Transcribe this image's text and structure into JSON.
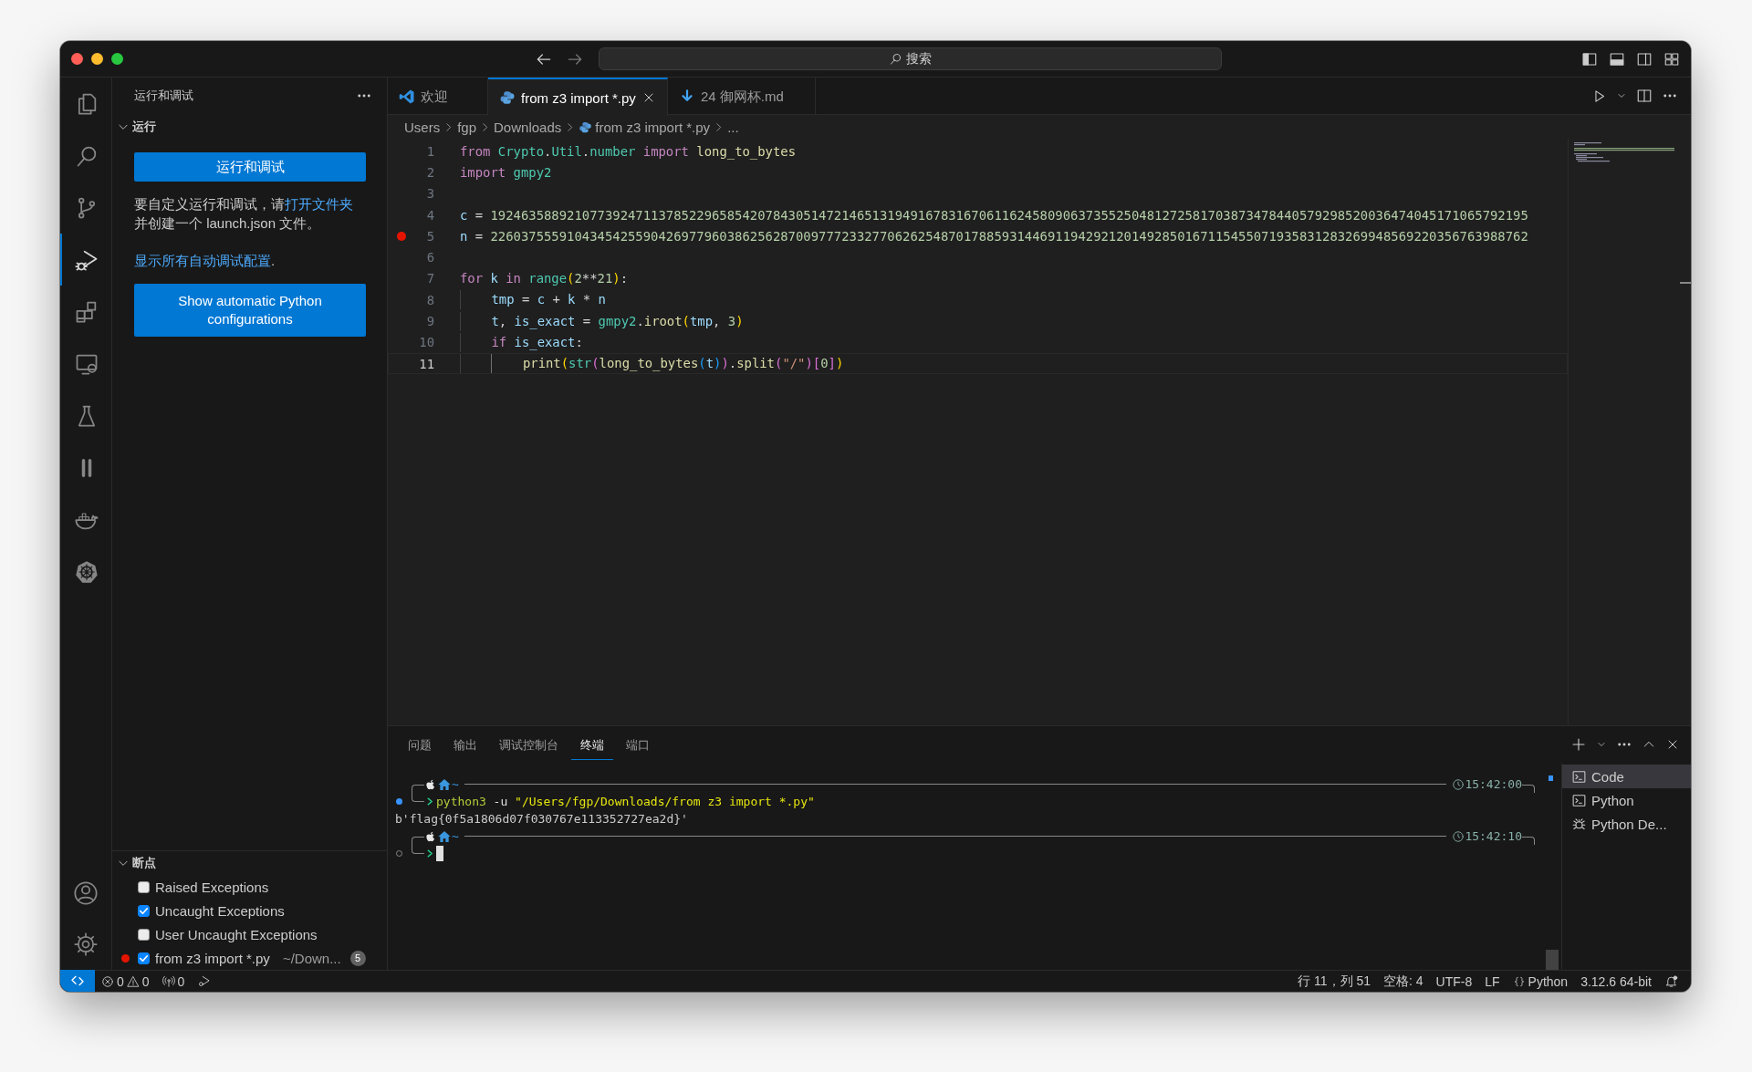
{
  "window": {
    "command_center": "搜索"
  },
  "activity_bar": [
    {
      "kind": "files",
      "selected": false
    },
    {
      "kind": "search",
      "selected": false
    },
    {
      "kind": "branch",
      "selected": false
    },
    {
      "kind": "debug",
      "selected": true
    },
    {
      "kind": "extensions",
      "selected": false
    },
    {
      "kind": "monitor",
      "selected": false
    },
    {
      "kind": "flask",
      "selected": false
    },
    {
      "kind": "pause",
      "selected": false
    },
    {
      "kind": "whale",
      "selected": false
    },
    {
      "kind": "wheel",
      "selected": false
    }
  ],
  "sidebar": {
    "title": "运行和调试",
    "section": "运行",
    "expanded": true,
    "run_button": "运行和调试",
    "help_before": "要自定义运行和调试，请",
    "help_link": "打开文件夹",
    "help_after": "并创建一个 launch.json 文件。",
    "show_all_link": "显示所有自动调试配置",
    "show_all_after": ".",
    "python_button": "Show automatic Python configurations",
    "breakpoints": {
      "title": "断点",
      "expanded": true,
      "items": [
        {
          "kind": "exception",
          "label": "Raised Exceptions",
          "checked": false
        },
        {
          "kind": "exception",
          "label": "Uncaught Exceptions",
          "checked": true
        },
        {
          "kind": "exception",
          "label": "User Uncaught Exceptions",
          "checked": false
        },
        {
          "kind": "file",
          "label": "from z3 import *.py",
          "path": "~/Down...",
          "count": "5",
          "checked": true
        }
      ]
    }
  },
  "tabs": [
    {
      "kind": "vscode",
      "label": "欢迎",
      "selected": false
    },
    {
      "kind": "python",
      "label": "from z3 import *.py",
      "selected": true
    },
    {
      "kind": "markdown",
      "label": "24 御网杯.md",
      "selected": false
    }
  ],
  "breadcrumb": [
    {
      "kind": "folder",
      "label": "Users"
    },
    {
      "kind": "folder",
      "label": "fgp"
    },
    {
      "kind": "folder",
      "label": "Downloads"
    },
    {
      "kind": "python",
      "label": "from z3 import *.py"
    },
    {
      "kind": "folder",
      "label": "..."
    }
  ],
  "code": [
    {
      "number": "1",
      "breakpoint": false,
      "current": false,
      "tokens": [
        {
          "text": "from ",
          "kind": "kw"
        },
        {
          "text": "Crypto",
          "kind": "mod"
        },
        {
          "text": ".",
          "kind": "op"
        },
        {
          "text": "Util",
          "kind": "mod"
        },
        {
          "text": ".",
          "kind": "op"
        },
        {
          "text": "number ",
          "kind": "mod"
        },
        {
          "text": "import ",
          "kind": "kw"
        },
        {
          "text": "long_to_bytes",
          "kind": "fn"
        }
      ]
    },
    {
      "number": "2",
      "breakpoint": false,
      "current": false,
      "tokens": [
        {
          "text": "import ",
          "kind": "kw"
        },
        {
          "text": "gmpy2",
          "kind": "mod"
        }
      ]
    },
    {
      "number": "3",
      "breakpoint": false,
      "current": false
    },
    {
      "number": "4",
      "breakpoint": false,
      "current": false,
      "tokens": [
        {
          "text": "c",
          "kind": "var"
        },
        {
          "text": " = ",
          "kind": "op"
        },
        {
          "text": "1924635889210773924711378522965854207843051472146513194916783167061162458090637355250481272581703873478440579298520036474045171065792195",
          "kind": "num"
        }
      ]
    },
    {
      "number": "5",
      "breakpoint": true,
      "current": false,
      "tokens": [
        {
          "text": "n",
          "kind": "var"
        },
        {
          "text": " = ",
          "kind": "op"
        },
        {
          "text": "2260375559104345425590426977960386256287009777233277062625487017885931446911942921201492850167115455071935831283269948569220356763988762",
          "kind": "num"
        }
      ]
    },
    {
      "number": "6",
      "breakpoint": false,
      "current": false
    },
    {
      "number": "7",
      "breakpoint": false,
      "current": false,
      "tokens": [
        {
          "text": "for ",
          "kind": "kw"
        },
        {
          "text": "k ",
          "kind": "var"
        },
        {
          "text": "in ",
          "kind": "kw"
        },
        {
          "text": "range",
          "kind": "mod"
        },
        {
          "text": "(",
          "kind": "b1"
        },
        {
          "text": "2",
          "kind": "num"
        },
        {
          "text": "**",
          "kind": "op"
        },
        {
          "text": "21",
          "kind": "num"
        },
        {
          "text": ")",
          "kind": "b1"
        },
        {
          "text": ":",
          "kind": "op"
        }
      ]
    },
    {
      "number": "8",
      "breakpoint": false,
      "current": false,
      "tokens": [
        {
          "text": "    tmp",
          "kind": "var"
        },
        {
          "text": " = ",
          "kind": "op"
        },
        {
          "text": "c",
          "kind": "var"
        },
        {
          "text": " + ",
          "kind": "op"
        },
        {
          "text": "k",
          "kind": "var"
        },
        {
          "text": " * ",
          "kind": "op"
        },
        {
          "text": "n",
          "kind": "var"
        }
      ]
    },
    {
      "number": "9",
      "breakpoint": false,
      "current": false,
      "tokens": [
        {
          "text": "    t",
          "kind": "var"
        },
        {
          "text": ", ",
          "kind": "op"
        },
        {
          "text": "is_exact",
          "kind": "var"
        },
        {
          "text": " = ",
          "kind": "op"
        },
        {
          "text": "gmpy2",
          "kind": "mod"
        },
        {
          "text": ".",
          "kind": "op"
        },
        {
          "text": "iroot",
          "kind": "fn"
        },
        {
          "text": "(",
          "kind": "b1"
        },
        {
          "text": "tmp",
          "kind": "var"
        },
        {
          "text": ", ",
          "kind": "op"
        },
        {
          "text": "3",
          "kind": "num"
        },
        {
          "text": ")",
          "kind": "b1"
        }
      ]
    },
    {
      "number": "10",
      "breakpoint": false,
      "current": false,
      "tokens": [
        {
          "text": "    if ",
          "kind": "kw"
        },
        {
          "text": "is_exact",
          "kind": "var"
        },
        {
          "text": ":",
          "kind": "op"
        }
      ]
    },
    {
      "number": "11",
      "breakpoint": false,
      "current": true,
      "tokens": [
        {
          "text": "        print",
          "kind": "fn"
        },
        {
          "text": "(",
          "kind": "b1"
        },
        {
          "text": "str",
          "kind": "mod"
        },
        {
          "text": "(",
          "kind": "b2"
        },
        {
          "text": "long_to_bytes",
          "kind": "fn"
        },
        {
          "text": "(",
          "kind": "b3"
        },
        {
          "text": "t",
          "kind": "var"
        },
        {
          "text": ")",
          "kind": "b3"
        },
        {
          "text": ")",
          "kind": "b2"
        },
        {
          "text": ".",
          "kind": "op"
        },
        {
          "text": "split",
          "kind": "fn"
        },
        {
          "text": "(",
          "kind": "b2"
        },
        {
          "text": "\"/\"",
          "kind": "str"
        },
        {
          "text": ")",
          "kind": "b2"
        },
        {
          "text": "[",
          "kind": "b2"
        },
        {
          "text": "0",
          "kind": "num"
        },
        {
          "text": "]",
          "kind": "b2"
        },
        {
          "text": ")",
          "kind": "b1"
        }
      ]
    }
  ],
  "panel": {
    "tabs": [
      {
        "label": "问题",
        "selected": false
      },
      {
        "label": "输出",
        "selected": false
      },
      {
        "label": "调试控制台",
        "selected": false
      },
      {
        "label": "终端",
        "selected": true
      },
      {
        "label": "端口",
        "selected": false
      }
    ],
    "sessions": [
      {
        "dir": "~",
        "time": "15:42:00",
        "finished": true,
        "command": [
          {
            "text": "python3",
            "kind": "cmd"
          },
          {
            "text": " -u ",
            "kind": "arg"
          },
          {
            "text": "\"/Users/fgp/Downloads/from z3 import *.py\"",
            "kind": "str"
          }
        ],
        "output": [
          "b'flag{0f5a1806d07f030767e113352727ea2d}'"
        ]
      },
      {
        "dir": "~",
        "time": "15:42:10",
        "finished": false,
        "cursor": true
      }
    ],
    "terminals": [
      {
        "kind": "terminal",
        "label": "Code",
        "selected": true
      },
      {
        "kind": "terminal",
        "label": "Python",
        "selected": false
      },
      {
        "kind": "debug",
        "label": "Python De...",
        "selected": false
      }
    ]
  },
  "status_bar": {
    "errors": "0",
    "warnings": "0",
    "ports": "0",
    "position": "行 11，列 51",
    "indent": "空格: 4",
    "encoding": "UTF-8",
    "eol": "LF",
    "language": "Python",
    "interpreter": "3.12.6 64-bit"
  }
}
